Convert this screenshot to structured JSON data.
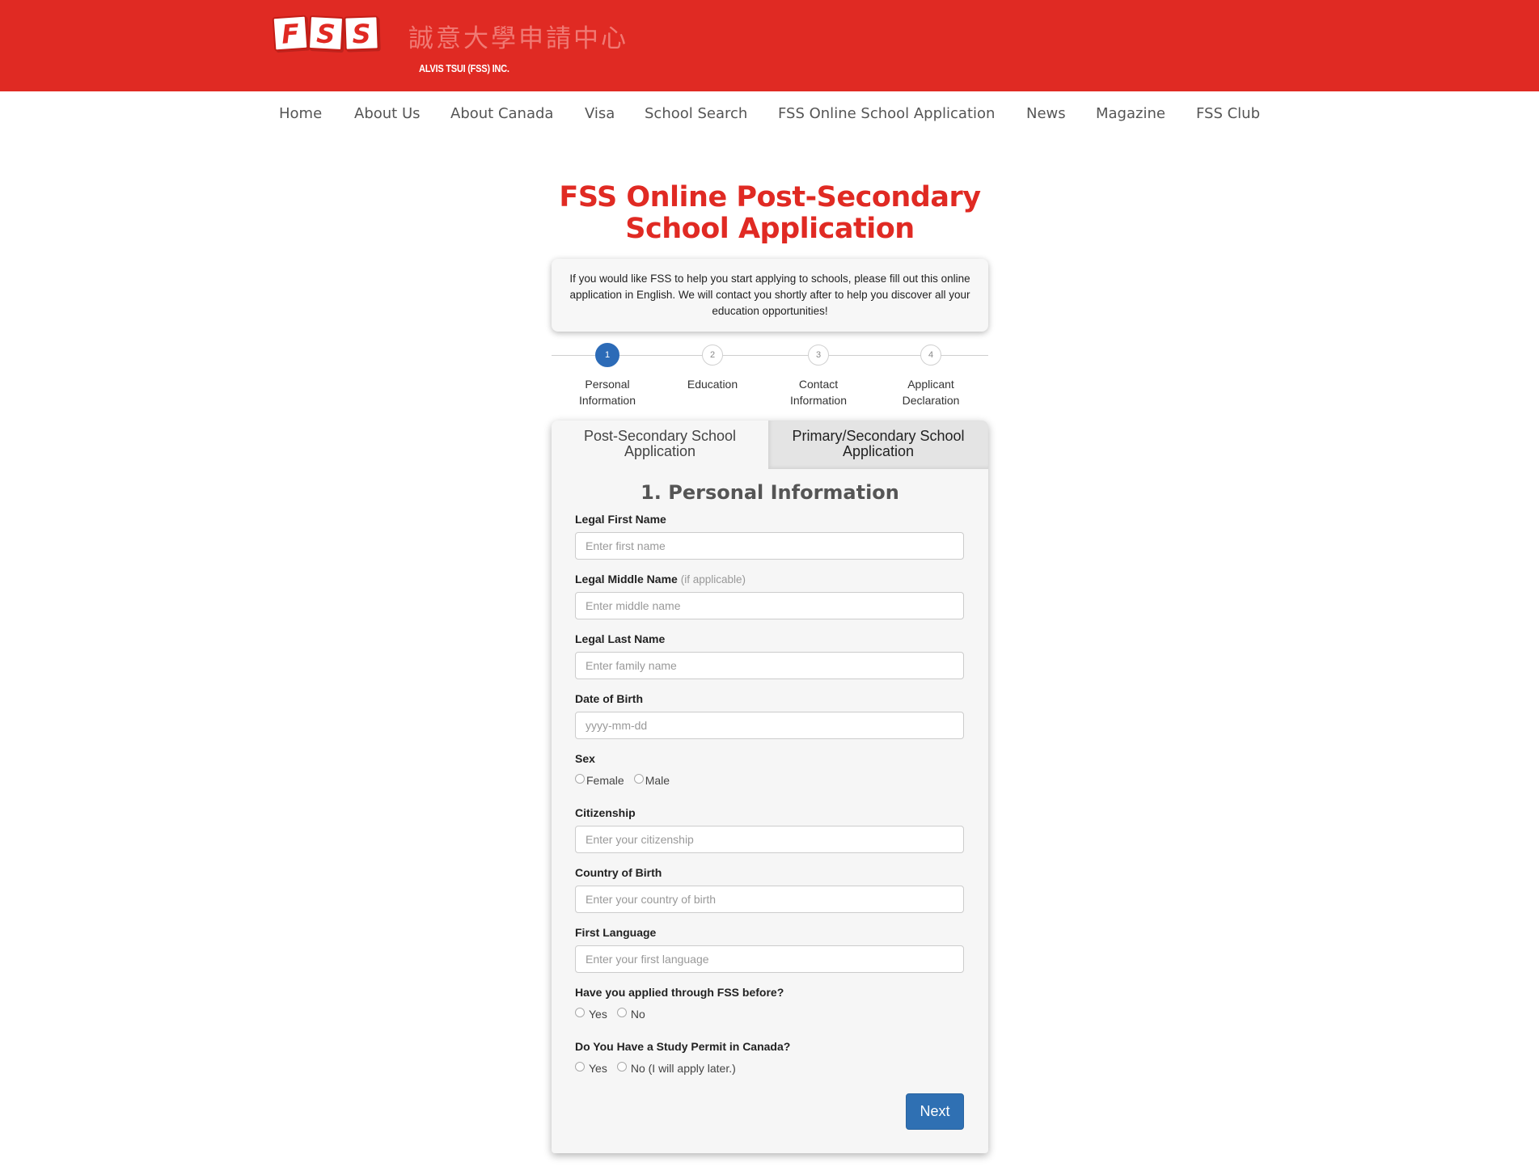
{
  "header": {
    "logo_letters": [
      "F",
      "S",
      "S"
    ],
    "chinese_name": "誠意大學申請中心",
    "company_name": "ALVIS TSUI (FSS) INC."
  },
  "nav": {
    "items": [
      {
        "label": "Home"
      },
      {
        "label": "About Us"
      },
      {
        "label": "About Canada"
      },
      {
        "label": "Visa"
      },
      {
        "label": "School Search"
      },
      {
        "label": "FSS Online School Application"
      },
      {
        "label": "News"
      },
      {
        "label": "Magazine"
      },
      {
        "label": "FSS Club"
      }
    ]
  },
  "page": {
    "title_line1": "FSS Online Post-Secondary",
    "title_line2": "School Application",
    "intro": "If you would like FSS to help you start applying to schools, please fill out this online application in English. We will contact you shortly after to help you discover all your education opportunities!"
  },
  "steps": [
    {
      "number": "1",
      "label_line1": "Personal",
      "label_line2": "Information",
      "active": true
    },
    {
      "number": "2",
      "label_line1": "Education",
      "label_line2": "",
      "active": false
    },
    {
      "number": "3",
      "label_line1": "Contact",
      "label_line2": "Information",
      "active": false
    },
    {
      "number": "4",
      "label_line1": "Applicant",
      "label_line2": "Declaration",
      "active": false
    }
  ],
  "tabs": {
    "post_secondary_line1": "Post-Secondary School",
    "post_secondary_line2": "Application",
    "primary_secondary_line1": "Primary/Secondary School",
    "primary_secondary_line2": "Application"
  },
  "form": {
    "section_title": "1. Personal Information",
    "first_name": {
      "label": "Legal First Name",
      "placeholder": "Enter first name",
      "value": ""
    },
    "middle_name": {
      "label": "Legal Middle Name",
      "hint": "(if applicable)",
      "placeholder": "Enter middle name",
      "value": ""
    },
    "last_name": {
      "label": "Legal Last Name",
      "placeholder": "Enter family name",
      "value": ""
    },
    "dob": {
      "label": "Date of Birth",
      "placeholder": "yyyy-mm-dd",
      "value": ""
    },
    "sex": {
      "label": "Sex",
      "options": [
        "Female",
        "Male"
      ]
    },
    "citizenship": {
      "label": "Citizenship",
      "placeholder": "Enter your citizenship",
      "value": ""
    },
    "country_of_birth": {
      "label": "Country of Birth",
      "placeholder": "Enter your country of birth",
      "value": ""
    },
    "first_language": {
      "label": "First Language",
      "placeholder": "Enter your first language",
      "value": ""
    },
    "applied_before": {
      "label": "Have you applied through FSS before?",
      "options": [
        "Yes",
        "No"
      ]
    },
    "study_permit": {
      "label": "Do You Have a Study Permit in Canada?",
      "options": [
        "Yes",
        "No (I will apply later.)"
      ]
    },
    "next_label": "Next"
  },
  "colors": {
    "brand_red": "#e02a23",
    "primary_blue": "#2f70b3"
  }
}
